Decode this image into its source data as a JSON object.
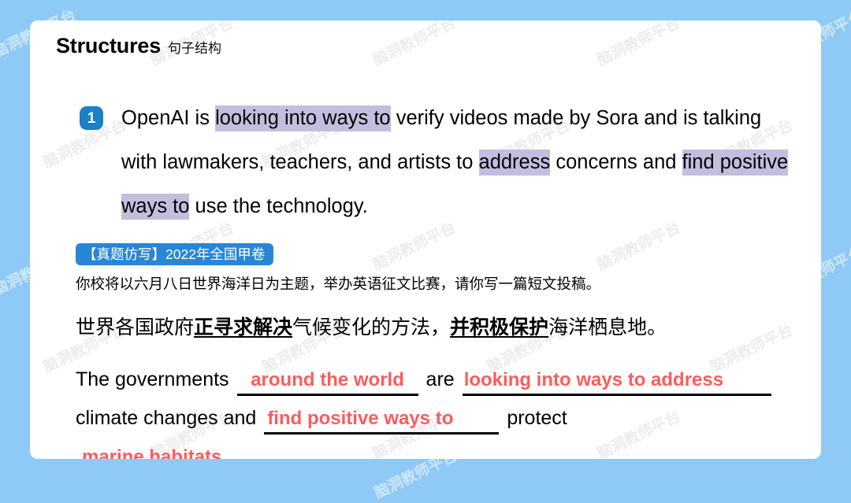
{
  "page": {
    "background_color": "#8fc9f5",
    "card_color": "#ffffff"
  },
  "heading": {
    "title_en": "Structures",
    "title_zh": "句子结构"
  },
  "structure": {
    "number": "1",
    "parts": [
      {
        "text": "OpenAI is ",
        "highlight": false
      },
      {
        "text": "looking into ways to",
        "highlight": true
      },
      {
        "text": " verify videos made by Sora and is talking with lawmakers, teachers, and artists to ",
        "highlight": false
      },
      {
        "text": "address",
        "highlight": true
      },
      {
        "text": " concerns and ",
        "highlight": false
      },
      {
        "text": "find positive ways to",
        "highlight": true
      },
      {
        "text": " use the technology.",
        "highlight": false
      }
    ],
    "highlight_color": "#c3bede",
    "badge_color": "#1a80c8"
  },
  "exam": {
    "tag_label": "【真题仿写】2022年全国甲卷",
    "tag_color": "#2986d4",
    "prompt_zh": "你校将以六月八日世界海洋日为主题，举办英语征文比赛，请你写一篇短文投稿。",
    "target_zh": {
      "seg1": "世界各国政府",
      "key1": "正寻求解决",
      "seg2": "气候变化的方法，",
      "key2": "并积极保护",
      "seg3": "海洋栖息地。"
    }
  },
  "answer": {
    "accent_color": "#fc5c5c",
    "line1": {
      "lead": "The governments",
      "blank1": "around the world",
      "mid": "are",
      "blank2": "looking into ways to address"
    },
    "line2": {
      "lead": "climate changes and",
      "blank3": "find positive ways to",
      "trail": "protect"
    },
    "line3": {
      "blank4": "marine habitats",
      "period": "."
    }
  },
  "watermark": {
    "text": "脑洞教师平台"
  }
}
